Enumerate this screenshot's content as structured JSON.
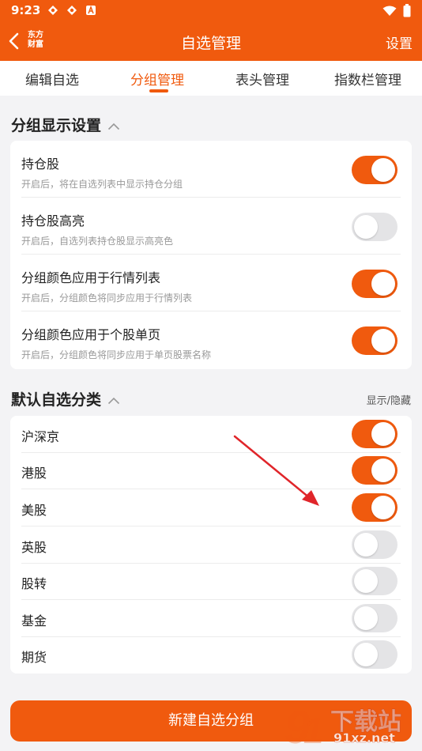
{
  "status": {
    "time": "9:23"
  },
  "nav": {
    "logo_line1": "东方",
    "logo_line2": "财富",
    "title": "自选管理",
    "settings": "设置"
  },
  "tabs": [
    "编辑自选",
    "分组管理",
    "表头管理",
    "指数栏管理"
  ],
  "group_display": {
    "title": "分组显示设置",
    "items": [
      {
        "title": "持仓股",
        "subtitle": "开启后，将在自选列表中显示持仓分组",
        "on": true
      },
      {
        "title": "持仓股高亮",
        "subtitle": "开启后，自选列表持仓股显示高亮色",
        "on": false
      },
      {
        "title": "分组颜色应用于行情列表",
        "subtitle": "开启后，分组颜色将同步应用于行情列表",
        "on": true
      },
      {
        "title": "分组颜色应用于个股单页",
        "subtitle": "开启后，分组颜色将同步应用于单页股票名称",
        "on": true
      }
    ]
  },
  "default_categories": {
    "title": "默认自选分类",
    "action": "显示/隐藏",
    "items": [
      {
        "title": "沪深京",
        "on": true
      },
      {
        "title": "港股",
        "on": true
      },
      {
        "title": "美股",
        "on": true
      },
      {
        "title": "英股",
        "on": false
      },
      {
        "title": "股转",
        "on": false
      },
      {
        "title": "基金",
        "on": false
      },
      {
        "title": "期货",
        "on": false
      }
    ]
  },
  "new_group_button": "新建自选分组",
  "watermark": {
    "line1": "下载站",
    "line2": "91xz.net"
  },
  "colors": {
    "accent": "#f05a0e",
    "toggle_off": "#e4e4e6",
    "background": "#f3f3f5"
  }
}
